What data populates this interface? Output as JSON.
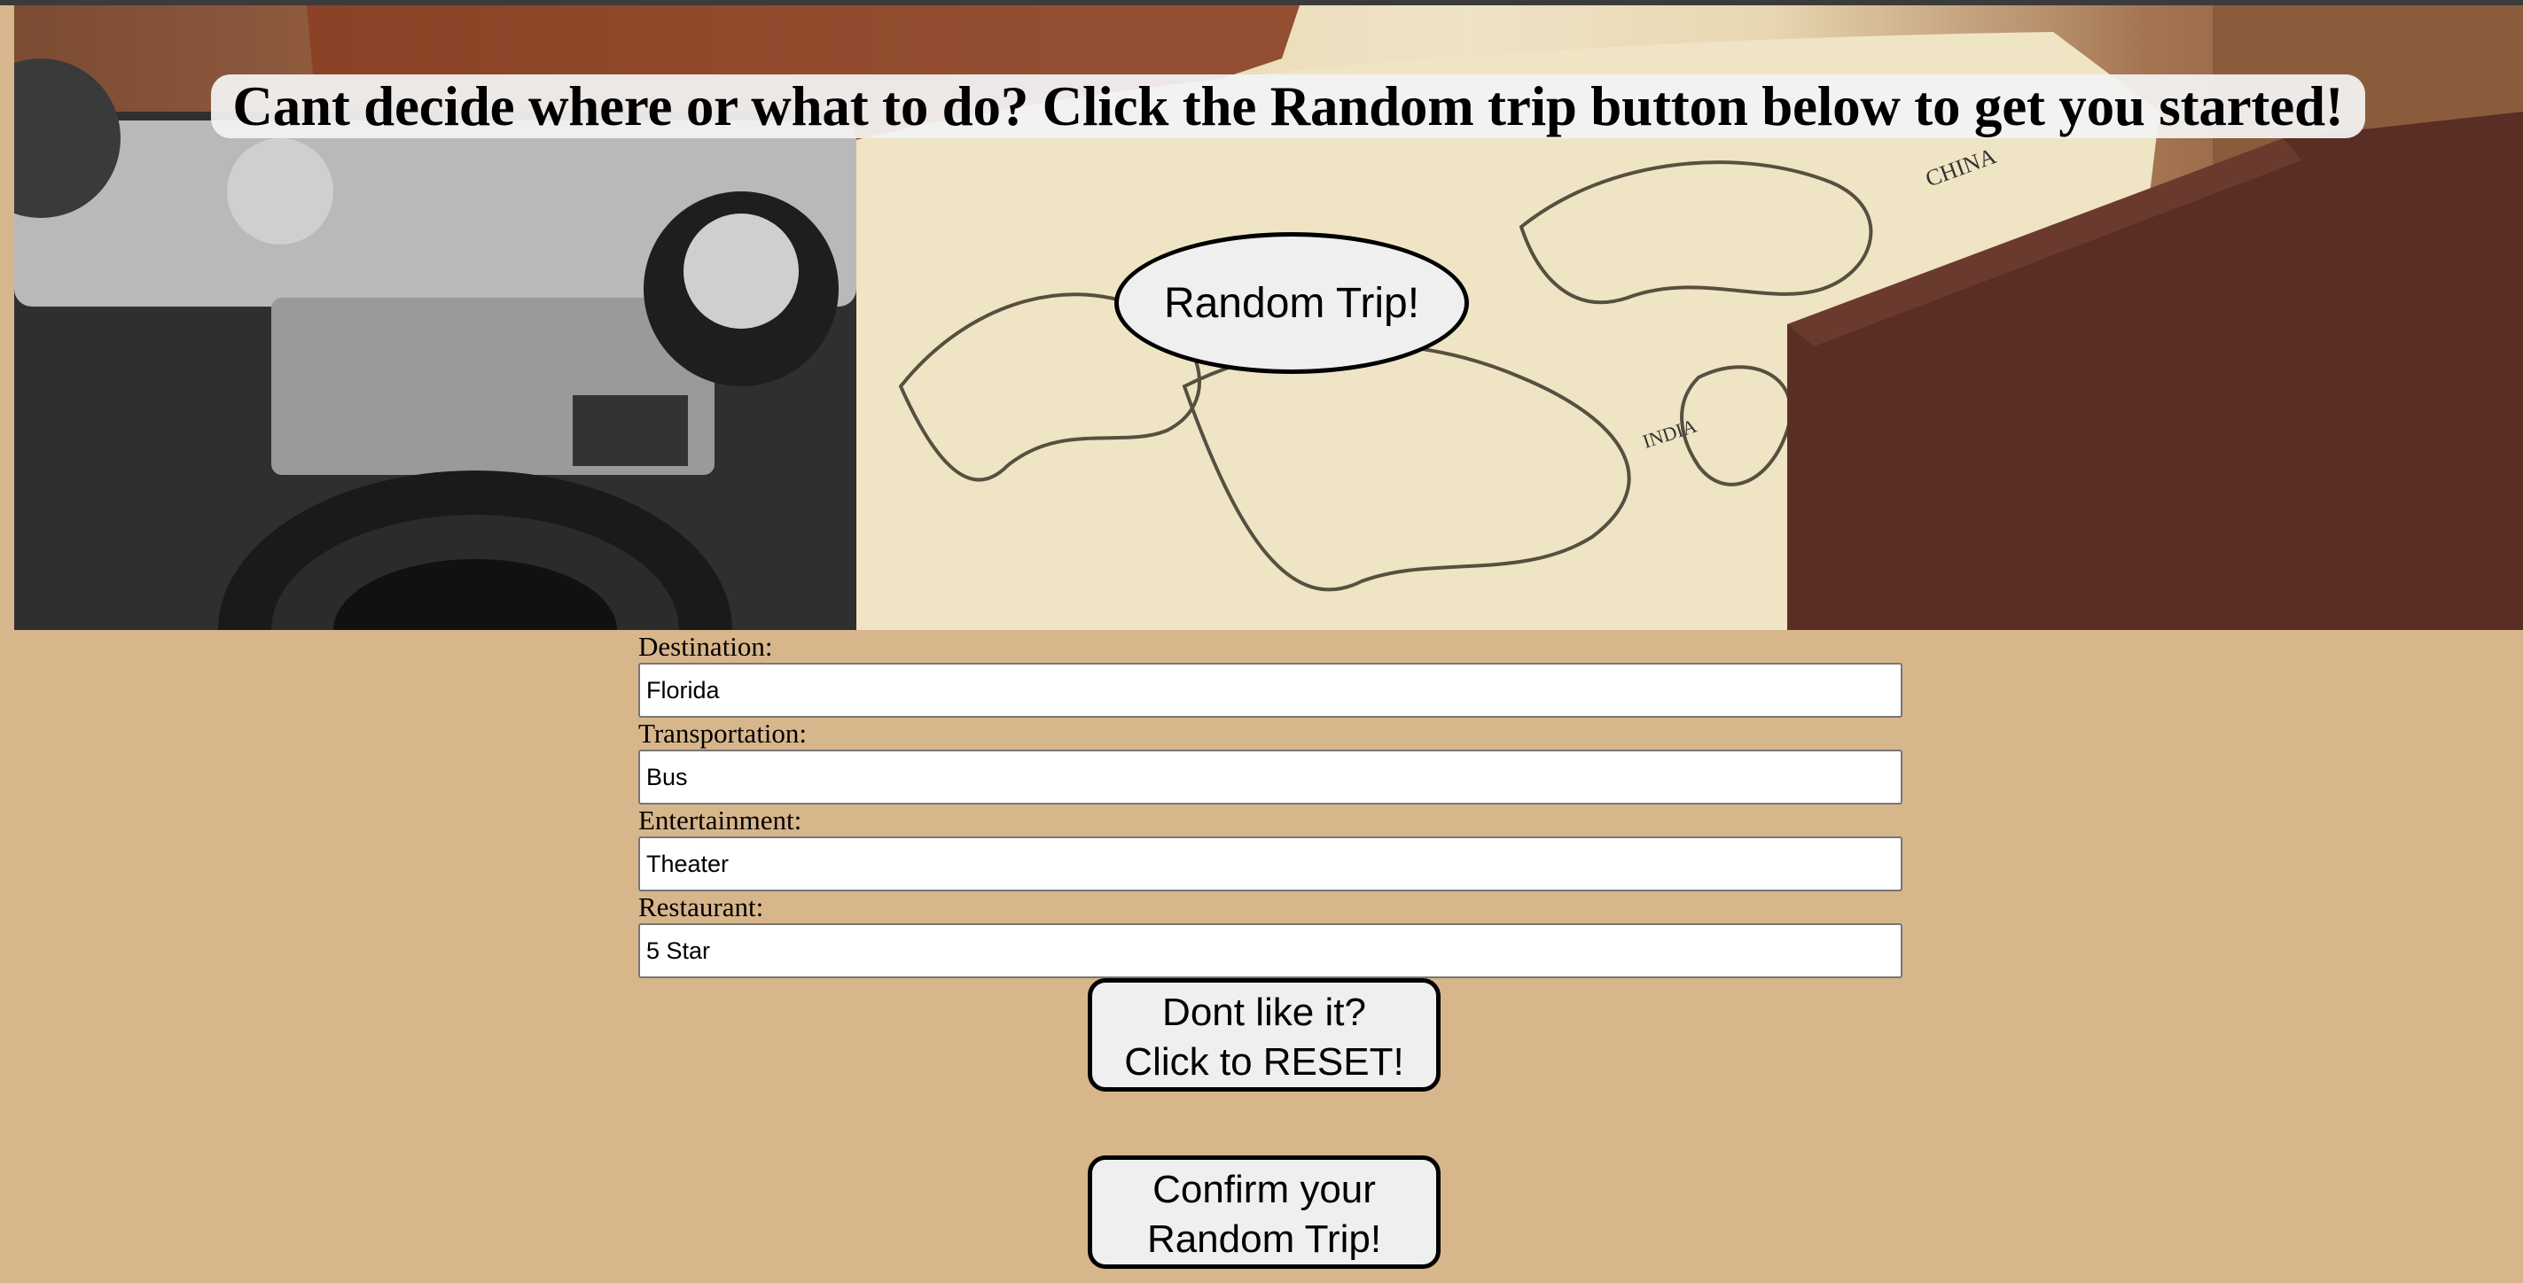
{
  "headline": "Cant decide where or what to do? Click the Random trip button below to get you started!",
  "random_button": "Random Trip!",
  "form": {
    "destination": {
      "label": "Destination:",
      "value": "Florida"
    },
    "transportation": {
      "label": "Transportation:",
      "value": "Bus"
    },
    "entertainment": {
      "label": "Entertainment:",
      "value": "Theater"
    },
    "restaurant": {
      "label": "Restaurant:",
      "value": "5 Star"
    }
  },
  "reset_button": {
    "line1": "Dont like it?",
    "line2": "Click to RESET!"
  },
  "confirm_button": {
    "line1": "Confirm your",
    "line2": "Random Trip!"
  },
  "map_labels": {
    "china": "CHINA",
    "india": "INDIA"
  },
  "colors": {
    "page_background": "#d8b68b",
    "button_background": "#efefef",
    "border": "#000000"
  }
}
